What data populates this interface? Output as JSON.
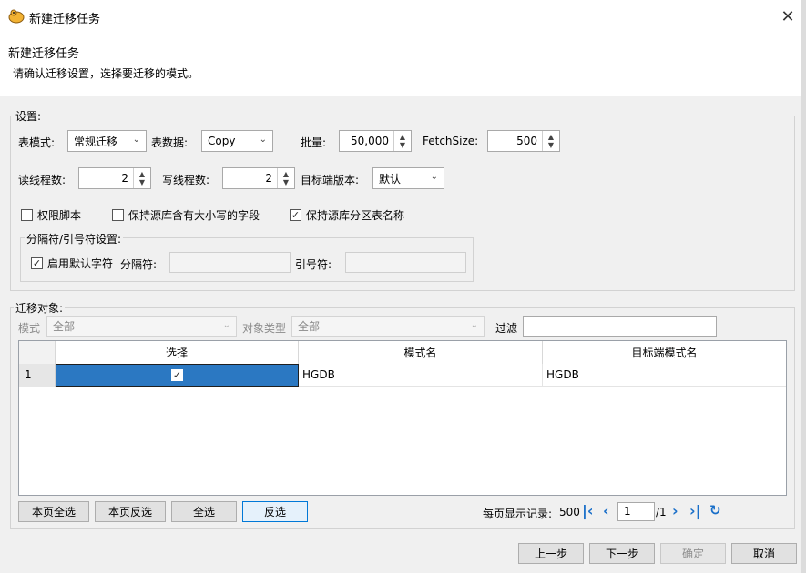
{
  "window": {
    "title": "新建迁移任务",
    "close_symbol": "✕"
  },
  "header": {
    "title": "新建迁移任务",
    "description": "请确认迁移设置，选择要迁移的模式。"
  },
  "settings": {
    "legend": "设置:",
    "table_mode_label": "表模式:",
    "table_mode_value": "常规迁移",
    "table_data_label": "表数据:",
    "table_data_value": "Copy",
    "batch_label": "批量:",
    "batch_value": "50,000",
    "fetchsize_label": "FetchSize:",
    "fetchsize_value": "500",
    "read_threads_label": "读线程数:",
    "read_threads_value": "2",
    "write_threads_label": "写线程数:",
    "write_threads_value": "2",
    "target_version_label": "目标端版本:",
    "target_version_value": "默认",
    "checkboxes": [
      {
        "label": "权限脚本",
        "checked": false
      },
      {
        "label": "保持源库含有大小写的字段",
        "checked": false
      },
      {
        "label": "保持源库分区表名称",
        "checked": true
      }
    ],
    "delimiter_group": {
      "legend": "分隔符/引号符设置:",
      "use_default_label": "启用默认字符",
      "use_default_checked": true,
      "separator_label": "分隔符:",
      "quote_label": "引号符:"
    }
  },
  "objects": {
    "legend": "迁移对象:",
    "mode_label": "模式",
    "mode_value": "全部",
    "object_type_label": "对象类型",
    "object_type_value": "全部",
    "filter_label": "过滤",
    "filter_value": "",
    "columns": [
      "选择",
      "模式名",
      "目标端模式名"
    ],
    "rows": [
      {
        "index": "1",
        "selected": true,
        "schema": "HGDB",
        "target_schema": "HGDB"
      }
    ]
  },
  "actions": {
    "select_page": "本页全选",
    "invert_page": "本页反选",
    "select_all": "全选",
    "invert_all": "反选"
  },
  "pagination": {
    "per_page_label": "每页显示记录:",
    "per_page_value": "500",
    "current_page": "1",
    "total_pages": "/1"
  },
  "footer": {
    "prev": "上一步",
    "next": "下一步",
    "ok": "确定",
    "cancel": "取消"
  },
  "icons": {
    "app": "migration-app-icon",
    "check": "✓",
    "dropdown": "⌄"
  },
  "colors": {
    "selection": "#2b78c2",
    "nav_accent": "#1a6fc9"
  }
}
